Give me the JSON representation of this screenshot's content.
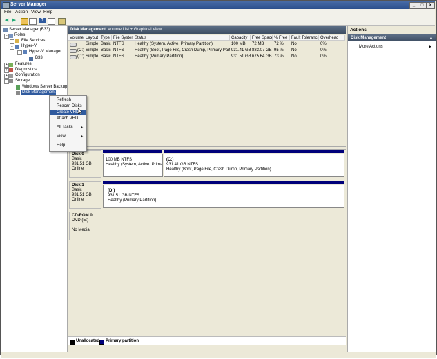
{
  "window": {
    "title": "Server Manager"
  },
  "menu": [
    "File",
    "Action",
    "View",
    "Help"
  ],
  "toolbar": {
    "icons": [
      "back-icon",
      "forward-icon",
      "up-folder-icon",
      "console-tree-icon",
      "help-icon",
      "properties-icon",
      "refresh-icon"
    ]
  },
  "tree": {
    "root": "Server Manager (B33)",
    "roles": "Roles",
    "file_services": "File Services",
    "hyperv": "Hyper-V",
    "hyperv_manager": "Hyper-V Manager",
    "b33": "B33",
    "features": "Features",
    "diagnostics": "Diagnostics",
    "configuration": "Configuration",
    "storage": "Storage",
    "wsb": "Windows Server Backup",
    "disk_management": "Disk Management"
  },
  "main": {
    "title": "Disk Management",
    "subtitle": "Volume List + Graphical View",
    "columns": [
      "Volume",
      "Layout",
      "Type",
      "File System",
      "Status",
      "Capacity",
      "Free Space",
      "% Free",
      "Fault Tolerance",
      "Overhead"
    ],
    "rows": [
      [
        "",
        "Simple",
        "Basic",
        "NTFS",
        "Healthy (System, Active, Primary Partition)",
        "100 MB",
        "72 MB",
        "72 %",
        "No",
        "0%"
      ],
      [
        "(C:)",
        "Simple",
        "Basic",
        "NTFS",
        "Healthy (Boot, Page File, Crash Dump, Primary Partition)",
        "931.41 GB",
        "883.07 GB",
        "95 %",
        "No",
        "0%"
      ],
      [
        "(D:)",
        "Simple",
        "Basic",
        "NTFS",
        "Healthy (Primary Partition)",
        "931.51 GB",
        "675.64 GB",
        "73 %",
        "No",
        "0%"
      ]
    ]
  },
  "disks": [
    {
      "name": "Disk 0",
      "type": "Basic",
      "size": "931.51 GB",
      "state": "Online",
      "partitions": [
        {
          "label": "",
          "size": "100 MB NTFS",
          "status": "Healthy (System, Active, Primary P"
        },
        {
          "label": "(C:)",
          "size": "931.41 GB NTFS",
          "status": "Healthy (Boot, Page File, Crash Dump, Primary Partition)"
        }
      ]
    },
    {
      "name": "Disk 1",
      "type": "Basic",
      "size": "931.51 GB",
      "state": "Online",
      "partitions": [
        {
          "label": "(D:)",
          "size": "931.51 GB NTFS",
          "status": "Healthy (Primary Partition)"
        }
      ]
    },
    {
      "name": "CD-ROM 0",
      "type": "DVD (E:)",
      "size": "",
      "state": "No Media",
      "partitions": []
    }
  ],
  "legend": {
    "unallocated": "Unallocated",
    "primary": "Primary partition",
    "unallocated_color": "#000000",
    "primary_color": "#00007a"
  },
  "actions": {
    "header": "Actions",
    "section": "Disk Management",
    "more": "More Actions"
  },
  "context_menu": {
    "items": [
      "Refresh",
      "Rescan Disks",
      "Create VHD",
      "Attach VHD",
      "All Tasks",
      "View",
      "Help"
    ],
    "highlighted": "Create VHD",
    "highlight_color": "#2f5a9e"
  }
}
